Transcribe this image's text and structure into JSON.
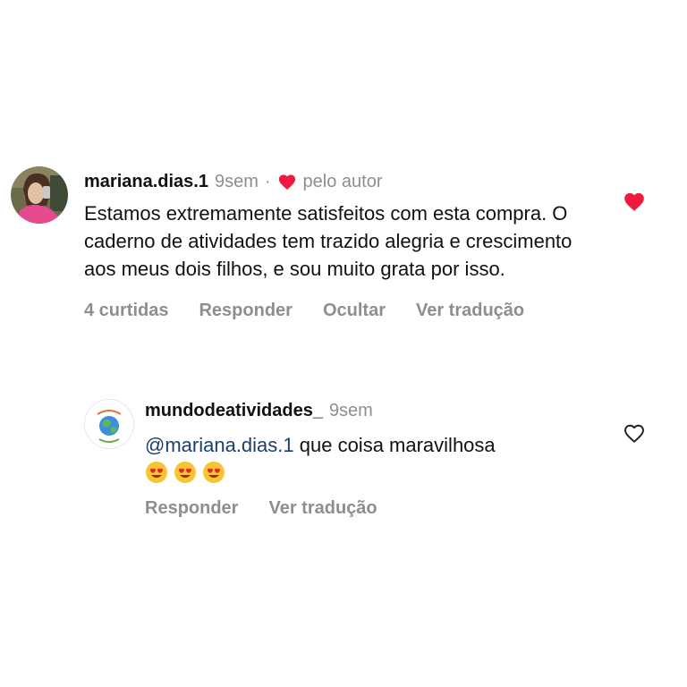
{
  "comments": [
    {
      "username": "mariana.dias.1",
      "time": "9sem",
      "separator": "·",
      "author_badge": "pelo autor",
      "text": "Estamos extremamente satisfeitos com esta compra. O caderno de atividades tem trazido alegria e crescimento aos meus dois filhos, e sou muito grata por isso.",
      "actions": {
        "likes": "4 curtidas",
        "reply": "Responder",
        "hide": "Ocultar",
        "translate": "Ver tradução"
      },
      "liked": true,
      "like_icon": "heart-filled-icon"
    },
    {
      "username": "mundodeatividades_",
      "time": "9sem",
      "mention": "@mariana.dias.1",
      "text": " que coisa maravilhosa",
      "emojis": [
        "😍",
        "😍",
        "😍"
      ],
      "actions": {
        "reply": "Responder",
        "translate": "Ver tradução"
      },
      "liked": false,
      "like_icon": "heart-outline-icon"
    }
  ],
  "colors": {
    "heart_red": "#ef1b3e",
    "muted": "#8e8e8e",
    "mention": "#1c3f6e"
  }
}
